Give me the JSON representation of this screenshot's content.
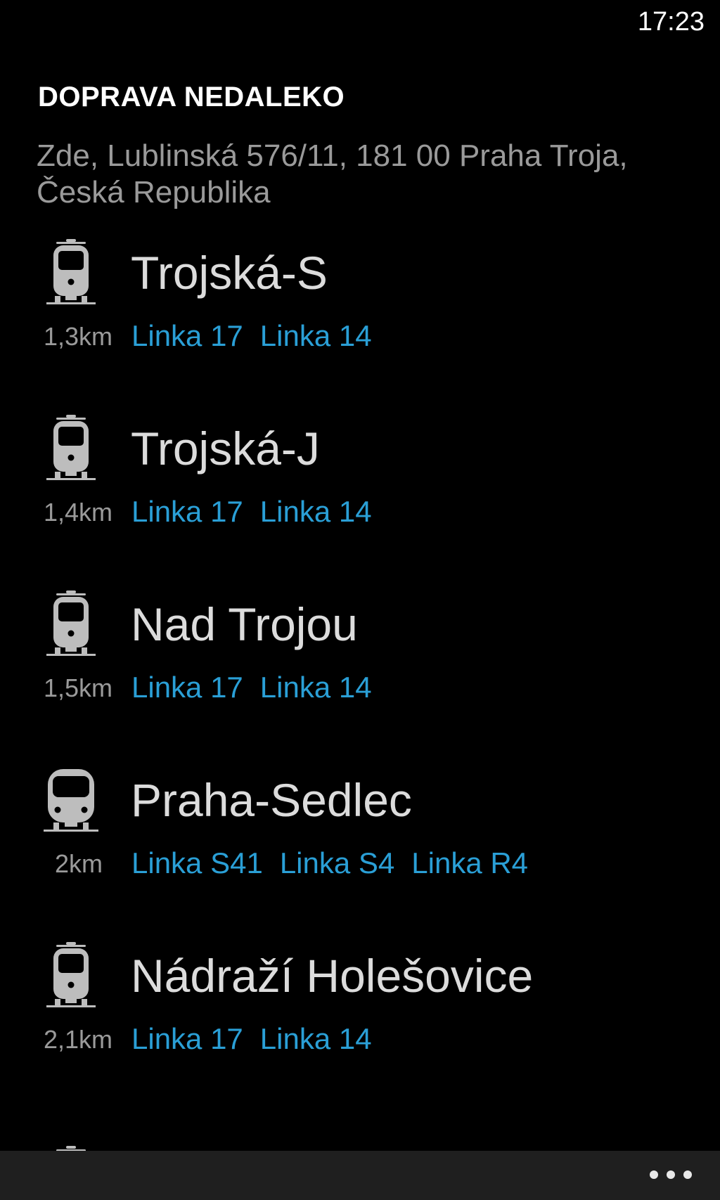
{
  "status_bar": {
    "time": "17:23"
  },
  "header": {
    "title": "DOPRAVA NEDALEKO",
    "location": "Zde, Lublinská 576/11, 181 00 Praha Troja, Česká Republika"
  },
  "stops": [
    {
      "name": "Trojská-S",
      "distance": "1,3km",
      "icon": "tram-icon",
      "lines": [
        "Linka 17",
        "Linka 14"
      ]
    },
    {
      "name": "Trojská-J",
      "distance": "1,4km",
      "icon": "tram-icon",
      "lines": [
        "Linka 17",
        "Linka 14"
      ]
    },
    {
      "name": "Nad Trojou",
      "distance": "1,5km",
      "icon": "tram-icon",
      "lines": [
        "Linka 17",
        "Linka 14"
      ]
    },
    {
      "name": "Praha-Sedlec",
      "distance": "2km",
      "icon": "train-icon",
      "lines": [
        "Linka S41",
        "Linka S4",
        "Linka R4"
      ]
    },
    {
      "name": "Nádraží Holešovice",
      "distance": "2,1km",
      "icon": "tram-icon",
      "lines": [
        "Linka 17",
        "Linka 14"
      ]
    }
  ],
  "app_bar": {
    "more_icon": "more-icon"
  },
  "colors": {
    "background": "#000000",
    "accent": "#2a9fd6",
    "secondary_text": "#9a9a9a",
    "app_bar": "#1f1f1f"
  }
}
